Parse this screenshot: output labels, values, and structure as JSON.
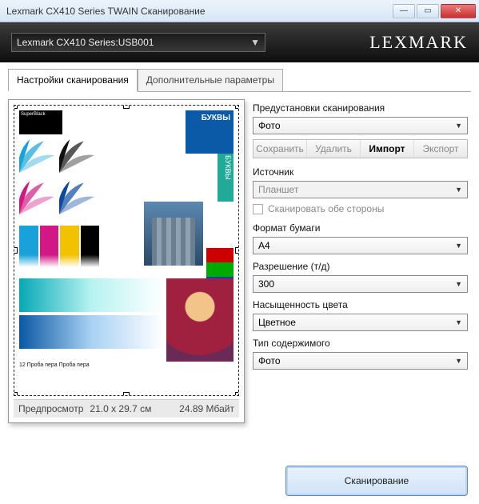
{
  "window": {
    "title": "Lexmark CX410 Series TWAIN Сканирование"
  },
  "toolbar": {
    "device": "Lexmark CX410 Series:USB001",
    "brand": "LEXMARK"
  },
  "tabs": {
    "scan": "Настройки сканирования",
    "advanced": "Дополнительные параметры"
  },
  "preview": {
    "label": "Предпросмотр",
    "dims": "21.0 x 29.7 см",
    "size": "24.89 Мбайт",
    "strip1": "БУКВЫ",
    "strip2": "БУКВЫ",
    "sb": "SuperBlack",
    "bottom": "12 Проба пера Проба пера"
  },
  "settings": {
    "presets_label": "Предустановки сканирования",
    "presets_value": "Фото",
    "btn_save": "Сохранить",
    "btn_delete": "Удалить",
    "btn_import": "Импорт",
    "btn_export": "Экспорт",
    "source_label": "Источник",
    "source_value": "Планшет",
    "duplex": "Сканировать обе стороны",
    "paper_label": "Формат бумаги",
    "paper_value": "A4",
    "dpi_label": "Разрешение (т/д)",
    "dpi_value": "300",
    "color_label": "Насыщенность цвета",
    "color_value": "Цветное",
    "content_label": "Тип содержимого",
    "content_value": "Фото"
  },
  "footer": {
    "scan": "Сканирование"
  }
}
